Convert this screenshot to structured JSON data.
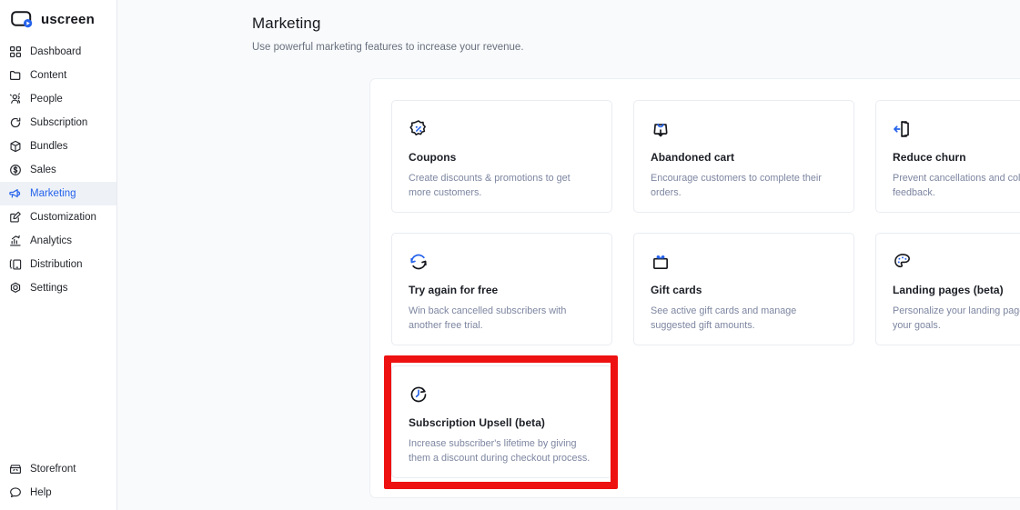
{
  "brand": {
    "name": "uscreen",
    "accent": "#2563eb",
    "logo_icon": "uscreen-play-logo"
  },
  "sidebar": {
    "items": [
      {
        "label": "Dashboard",
        "icon": "grid-icon",
        "active": false
      },
      {
        "label": "Content",
        "icon": "folder-icon",
        "active": false
      },
      {
        "label": "People",
        "icon": "people-icon",
        "active": false
      },
      {
        "label": "Subscription",
        "icon": "refresh-icon",
        "active": false
      },
      {
        "label": "Bundles",
        "icon": "box-icon",
        "active": false
      },
      {
        "label": "Sales",
        "icon": "dollar-circle-icon",
        "active": false
      },
      {
        "label": "Marketing",
        "icon": "megaphone-icon",
        "active": true
      },
      {
        "label": "Customization",
        "icon": "pencil-square-icon",
        "active": false
      },
      {
        "label": "Analytics",
        "icon": "chart-up-icon",
        "active": false
      },
      {
        "label": "Distribution",
        "icon": "devices-icon",
        "active": false
      },
      {
        "label": "Settings",
        "icon": "gear-icon",
        "active": false
      }
    ],
    "bottom_items": [
      {
        "label": "Storefront",
        "icon": "storefront-icon"
      },
      {
        "label": "Help",
        "icon": "chat-bubble-icon"
      }
    ]
  },
  "header": {
    "title": "Marketing",
    "subtitle": "Use powerful marketing features to increase your revenue."
  },
  "cards": [
    {
      "title": "Coupons",
      "desc": "Create discounts & promotions to get more customers.",
      "icon": "discount-badge-icon",
      "highlighted": false
    },
    {
      "title": "Abandoned cart",
      "desc": "Encourage customers to complete their orders.",
      "icon": "shopping-bag-arrow-icon",
      "highlighted": false
    },
    {
      "title": "Reduce churn",
      "desc": "Prevent cancellations and collect user feedback.",
      "icon": "exit-door-icon",
      "highlighted": false
    },
    {
      "title": "Try again for free",
      "desc": "Win back cancelled subscribers with another free trial.",
      "icon": "rotate-arrows-icon",
      "highlighted": false
    },
    {
      "title": "Gift cards",
      "desc": "See active gift cards and manage suggested gift amounts.",
      "icon": "gift-box-icon",
      "highlighted": false
    },
    {
      "title": "Landing pages (beta)",
      "desc": "Personalize your landing pages for any of your goals.",
      "icon": "palette-icon",
      "highlighted": false
    },
    {
      "title": "Subscription Upsell (beta)",
      "desc": "Increase subscriber's lifetime by giving them a discount during checkout process.",
      "icon": "clock-timer-icon",
      "highlighted": true
    }
  ],
  "annotation": {
    "color": "#ee1111",
    "target": "Subscription Upsell (beta)"
  }
}
